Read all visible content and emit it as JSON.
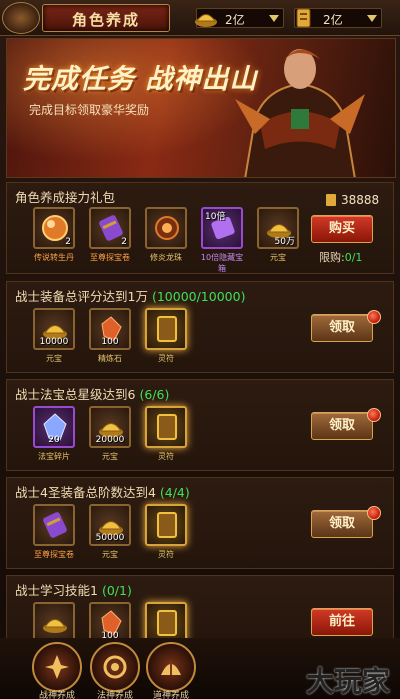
{
  "header": {
    "title": "角色养成",
    "resources": [
      {
        "icon": "gold-ingot-icon",
        "value": "2亿"
      },
      {
        "icon": "voucher-icon",
        "value": "2亿"
      }
    ]
  },
  "banner": {
    "headline": "完成任务  战神出山",
    "subtitle": "完成目标领取豪华奖励"
  },
  "gift_pack": {
    "title": "角色养成接力礼包",
    "price": "38888",
    "buy_label": "购买",
    "limit_label": "限购:",
    "limit_value": "0/1",
    "items": [
      {
        "name": "传说转生丹",
        "count": "2",
        "icon": "orb-icon"
      },
      {
        "name": "至尊探宝卷",
        "count": "2",
        "icon": "scroll-icon"
      },
      {
        "name": "修炎龙珠",
        "count": "",
        "icon": "dragon-pearl-icon"
      },
      {
        "name": "10倍隐藏宝箱",
        "count": "10倍",
        "icon": "purple-scroll-icon"
      },
      {
        "name": "元宝",
        "count": "50万",
        "icon": "gold-ingot-icon"
      }
    ]
  },
  "tasks": [
    {
      "title": "战士装备总评分达到1万",
      "progress": "(10000/10000)",
      "button": "领取",
      "items": [
        {
          "name": "元宝",
          "count": "10000",
          "icon": "gold-ingot-icon"
        },
        {
          "name": "精炼石",
          "count": "100",
          "icon": "refine-stone-icon"
        },
        {
          "name": "灵符",
          "count": "",
          "icon": "talisman-icon"
        }
      ]
    },
    {
      "title": "战士法宝总星级达到6",
      "progress": "(6/6)",
      "button": "领取",
      "items": [
        {
          "name": "法宝碎片",
          "count": "20",
          "icon": "crystal-icon"
        },
        {
          "name": "元宝",
          "count": "20000",
          "icon": "gold-ingot-icon"
        },
        {
          "name": "灵符",
          "count": "",
          "icon": "talisman-icon"
        }
      ]
    },
    {
      "title": "战士4圣装备总阶数达到4",
      "progress": "(4/4)",
      "button": "领取",
      "items": [
        {
          "name": "至尊探宝卷",
          "count": "",
          "icon": "scroll-icon"
        },
        {
          "name": "元宝",
          "count": "50000",
          "icon": "gold-ingot-icon"
        },
        {
          "name": "灵符",
          "count": "",
          "icon": "talisman-icon"
        }
      ]
    },
    {
      "title": "战士学习技能1",
      "progress": "(0/1)",
      "button": "前往",
      "items": [
        {
          "name": "",
          "count": "",
          "icon": "gold-ingot-icon"
        },
        {
          "name": "",
          "count": "100",
          "icon": "refine-stone-icon"
        },
        {
          "name": "",
          "count": "",
          "icon": "talisman-icon"
        }
      ]
    }
  ],
  "bottom_nav": [
    {
      "label": "战神养成",
      "icon": "warrior-emblem-icon"
    },
    {
      "label": "法神养成",
      "icon": "mage-emblem-icon"
    },
    {
      "label": "道神养成",
      "icon": "taoist-emblem-icon"
    }
  ],
  "watermark": "大玩家",
  "colors": {
    "progress": "#3fe05a",
    "gold": "#e6c46a",
    "button_red": "#d23a26"
  }
}
